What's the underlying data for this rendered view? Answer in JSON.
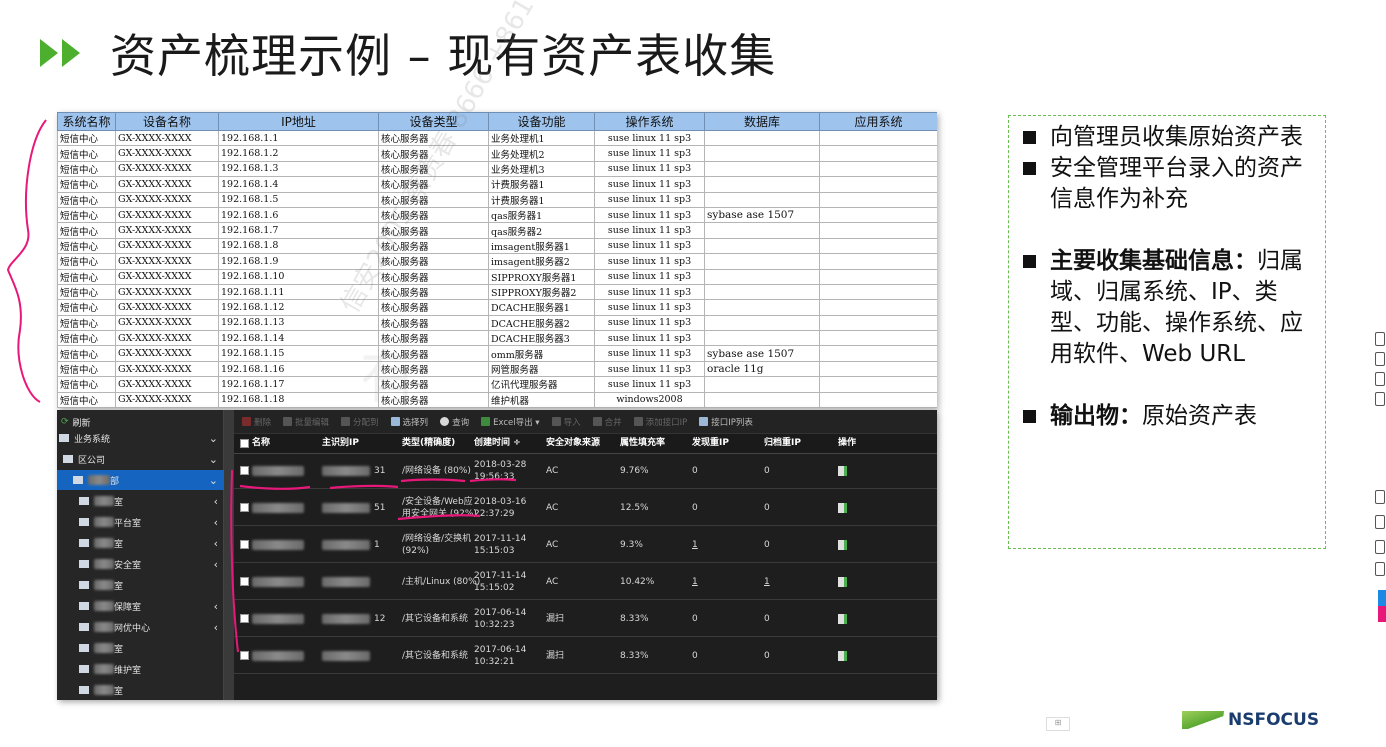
{
  "slide": {
    "title": "资产梳理示例 – 现有资产表收集",
    "watermark": "信安2005 蔡贵春 8666 +8617780617466",
    "watermark_org": "有",
    "brand": "NSFOCUS"
  },
  "sheet": {
    "headers": [
      "系统名称",
      "设备名称",
      "IP地址",
      "设备类型",
      "设备功能",
      "操作系统",
      "数据库",
      "应用系统"
    ],
    "rows": [
      [
        "短信中心",
        "GX-XXXX-XXXX",
        "192.168.1.1",
        "核心服务器",
        "业务处理机1",
        "suse linux 11 sp3",
        "",
        ""
      ],
      [
        "短信中心",
        "GX-XXXX-XXXX",
        "192.168.1.2",
        "核心服务器",
        "业务处理机2",
        "suse linux 11 sp3",
        "",
        ""
      ],
      [
        "短信中心",
        "GX-XXXX-XXXX",
        "192.168.1.3",
        "核心服务器",
        "业务处理机3",
        "suse linux 11 sp3",
        "",
        ""
      ],
      [
        "短信中心",
        "GX-XXXX-XXXX",
        "192.168.1.4",
        "核心服务器",
        "计费服务器1",
        "suse linux 11 sp3",
        "",
        ""
      ],
      [
        "短信中心",
        "GX-XXXX-XXXX",
        "192.168.1.5",
        "核心服务器",
        "计费服务器1",
        "suse linux 11 sp3",
        "",
        ""
      ],
      [
        "短信中心",
        "GX-XXXX-XXXX",
        "192.168.1.6",
        "核心服务器",
        "qas服务器1",
        "suse linux 11 sp3",
        "sybase ase 1507",
        ""
      ],
      [
        "短信中心",
        "GX-XXXX-XXXX",
        "192.168.1.7",
        "核心服务器",
        "qas服务器2",
        "suse linux 11 sp3",
        "",
        ""
      ],
      [
        "短信中心",
        "GX-XXXX-XXXX",
        "192.168.1.8",
        "核心服务器",
        "imsagent服务器1",
        "suse linux 11 sp3",
        "",
        ""
      ],
      [
        "短信中心",
        "GX-XXXX-XXXX",
        "192.168.1.9",
        "核心服务器",
        "imsagent服务器2",
        "suse linux 11 sp3",
        "",
        ""
      ],
      [
        "短信中心",
        "GX-XXXX-XXXX",
        "192.168.1.10",
        "核心服务器",
        "SIPPROXY服务器1",
        "suse linux 11 sp3",
        "",
        ""
      ],
      [
        "短信中心",
        "GX-XXXX-XXXX",
        "192.168.1.11",
        "核心服务器",
        "SIPPROXY服务器2",
        "suse linux 11 sp3",
        "",
        ""
      ],
      [
        "短信中心",
        "GX-XXXX-XXXX",
        "192.168.1.12",
        "核心服务器",
        "DCACHE服务器1",
        "suse linux 11 sp3",
        "",
        ""
      ],
      [
        "短信中心",
        "GX-XXXX-XXXX",
        "192.168.1.13",
        "核心服务器",
        "DCACHE服务器2",
        "suse linux 11 sp3",
        "",
        ""
      ],
      [
        "短信中心",
        "GX-XXXX-XXXX",
        "192.168.1.14",
        "核心服务器",
        "DCACHE服务器3",
        "suse linux 11 sp3",
        "",
        ""
      ],
      [
        "短信中心",
        "GX-XXXX-XXXX",
        "192.168.1.15",
        "核心服务器",
        "omm服务器",
        "suse linux 11 sp3",
        "sybase ase 1507",
        ""
      ],
      [
        "短信中心",
        "GX-XXXX-XXXX",
        "192.168.1.16",
        "核心服务器",
        "网管服务器",
        "suse linux 11 sp3",
        "oracle 11g",
        ""
      ],
      [
        "短信中心",
        "GX-XXXX-XXXX",
        "192.168.1.17",
        "核心服务器",
        "亿讯代理服务器",
        "suse linux 11 sp3",
        "",
        ""
      ],
      [
        "短信中心",
        "GX-XXXX-XXXX",
        "192.168.1.18",
        "核心服务器",
        "维护机器",
        "windows2008",
        "",
        ""
      ]
    ]
  },
  "app": {
    "sidebar": {
      "refresh": "刷新",
      "items": [
        {
          "label": "业务系统",
          "chev": "⌄"
        },
        {
          "label": "区公司",
          "chev": "⌄"
        },
        {
          "label": "部",
          "chev": "⌄"
        },
        {
          "label": "室",
          "chev": "‹"
        },
        {
          "label": "平台室",
          "chev": "‹"
        },
        {
          "label": "室",
          "chev": "‹"
        },
        {
          "label": "安全室",
          "chev": "‹"
        },
        {
          "label": "室",
          "chev": ""
        },
        {
          "label": "保障室",
          "chev": "‹"
        },
        {
          "label": "网优中心",
          "chev": "‹"
        },
        {
          "label": "室",
          "chev": ""
        },
        {
          "label": "维护室",
          "chev": ""
        },
        {
          "label": "室",
          "chev": ""
        }
      ]
    },
    "toolbar": {
      "delete": "删除",
      "batch_edit": "批量编辑",
      "assign": "分配到",
      "select_columns": "选择列",
      "query": "查询",
      "excel_export": "Excel导出 ▾",
      "import": "导入",
      "merge": "合并",
      "interface_ip": "接口IP列表",
      "add_interface_ip": "添加接口IP"
    },
    "grid": {
      "headers": [
        "名称",
        "主识别IP",
        "类型(精确度)",
        "创建时间 ÷",
        "安全对象来源",
        "属性填充率",
        "发现重IP",
        "归档重IP",
        "操作"
      ],
      "rows": [
        {
          "ip_tail": "31",
          "type": "/网络设备 (80%)",
          "time": "2018-03-28\n19:56:33",
          "source": "AC",
          "rate": "9.76%",
          "found": "0",
          "archived": "0"
        },
        {
          "ip_tail": "51",
          "type": "/安全设备/Web应\n用安全网关 (92%)",
          "time": "2018-03-16\n22:37:29",
          "source": "AC",
          "rate": "12.5%",
          "found": "0",
          "archived": "0"
        },
        {
          "ip_tail": "1",
          "type": "/网络设备/交换机\n(92%)",
          "time": "2017-11-14\n15:15:03",
          "source": "AC",
          "rate": "9.3%",
          "found": "1",
          "archived": "0"
        },
        {
          "ip_tail": "",
          "type": "/主机/Linux (80%)",
          "time": "2017-11-14\n15:15:02",
          "source": "AC",
          "rate": "10.42%",
          "found": "1",
          "archived": "1"
        },
        {
          "ip_tail": "12",
          "type": "/其它设备和系统",
          "time": "2017-06-14\n10:32:23",
          "source": "漏扫",
          "rate": "8.33%",
          "found": "0",
          "archived": "0"
        },
        {
          "ip_tail": "",
          "type": "/其它设备和系统",
          "time": "2017-06-14\n10:32:21",
          "source": "漏扫",
          "rate": "8.33%",
          "found": "0",
          "archived": "0"
        }
      ]
    }
  },
  "bullets": {
    "b1": "向管理员收集原始资产表",
    "b2": "安全管理平台录入的资产信息作为补充",
    "b3_bold": "主要收集基础信息：",
    "b3_text": "归属域、归属系统、IP、类型、功能、操作系统、应用软件、Web URL",
    "b4_bold": "输出物：",
    "b4_text": "原始资产表"
  },
  "colors": {
    "accent_green": "#4caf2e",
    "sheet_header": "#9ec4ee",
    "annotation_pink": "#e8187a",
    "app_selected": "#1565c0"
  }
}
